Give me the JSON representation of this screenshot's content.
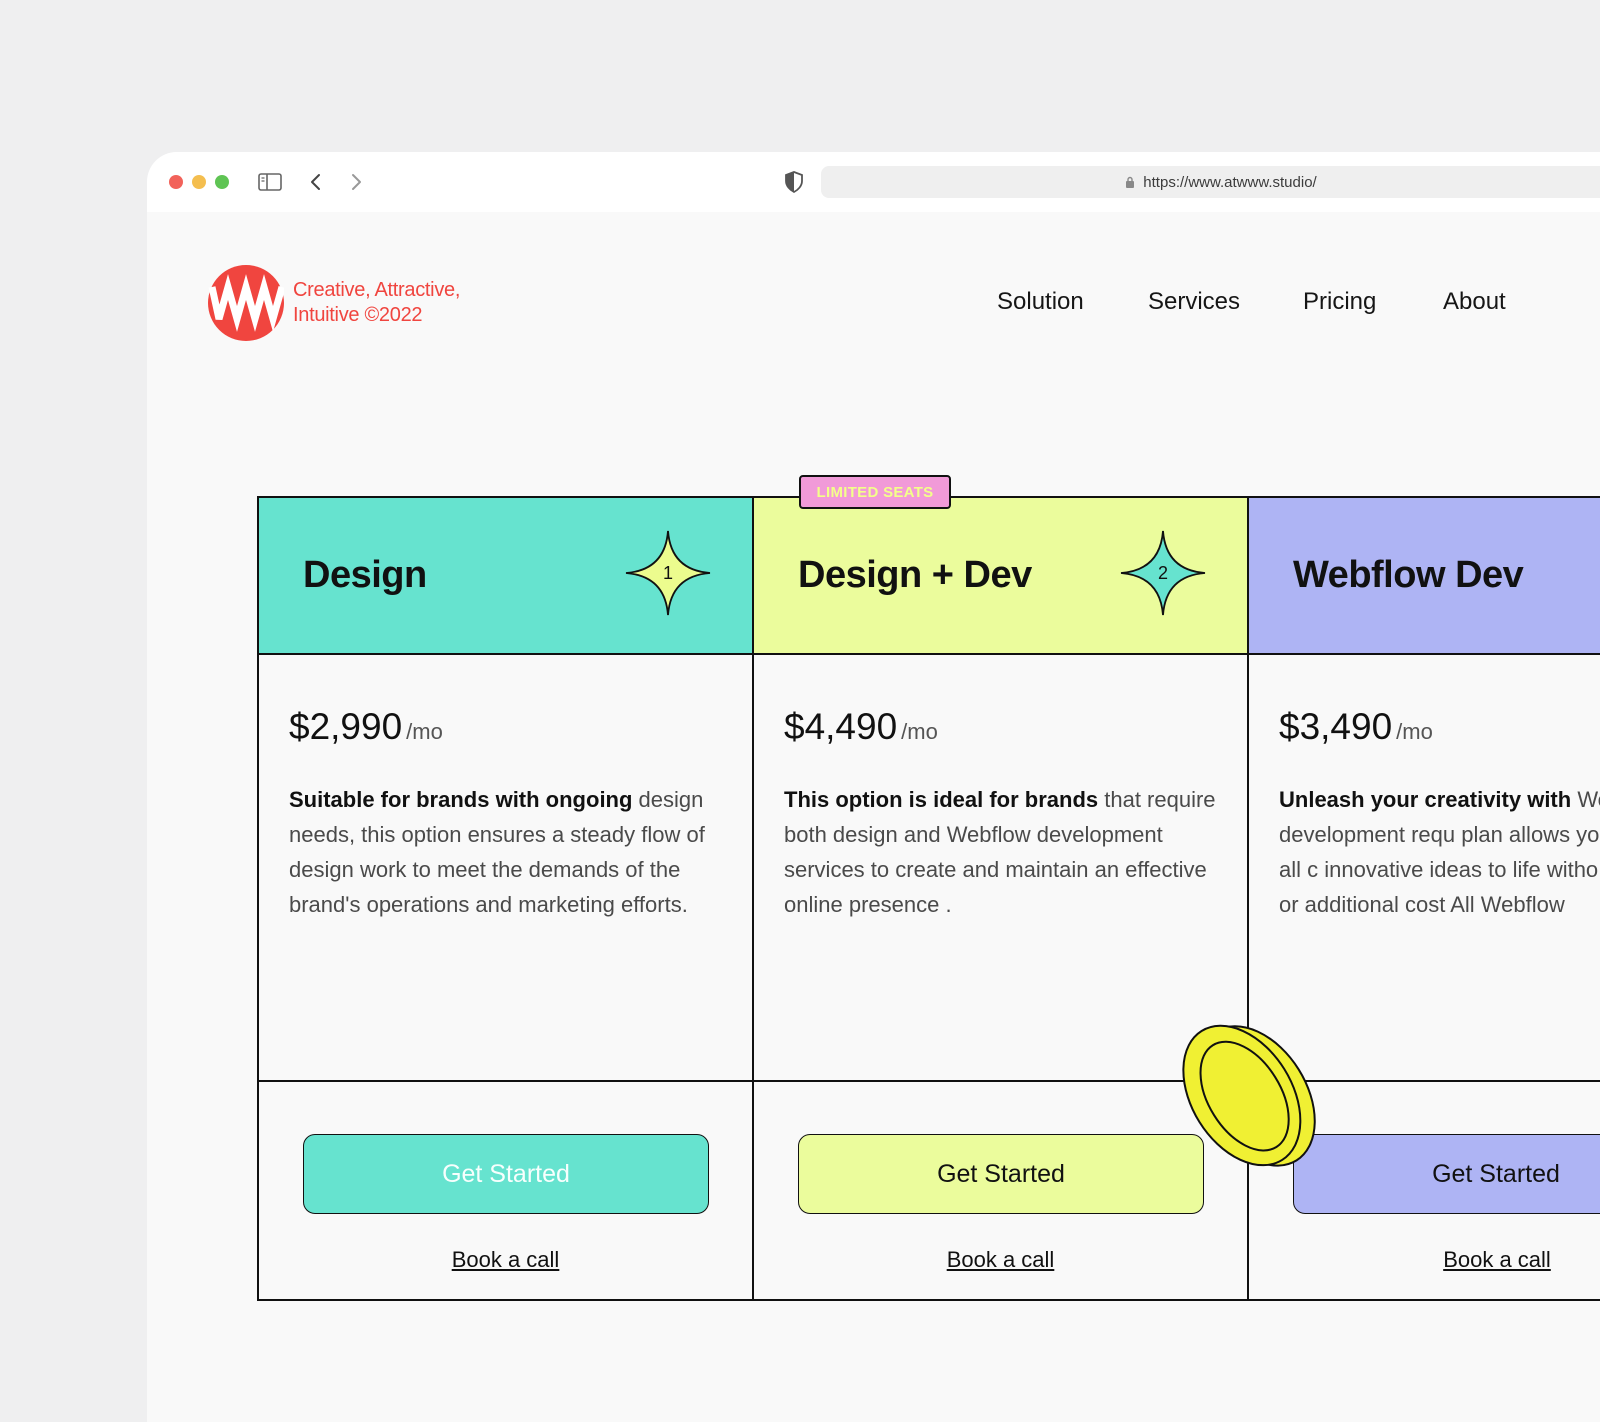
{
  "browser": {
    "url": "https://www.atwww.studio/"
  },
  "brand": {
    "tagline_line1": "Creative, Attractive,",
    "tagline_line2": "Intuitive ©2022",
    "logo_color": "#f0453f"
  },
  "nav": {
    "items": [
      {
        "label": "Solution"
      },
      {
        "label": "Services"
      },
      {
        "label": "Pricing"
      },
      {
        "label": "About"
      }
    ]
  },
  "badge": {
    "label": "LIMITED SEATS"
  },
  "plans": [
    {
      "title": "Design",
      "star_number": "1",
      "price": "$2,990",
      "period": "/mo",
      "desc_strong": "Suitable for brands with ongoing",
      "desc_rest": " design needs, this option ensures a steady flow of design work to meet the demands of the brand's operations and marketing efforts.",
      "cta": "Get Started",
      "link": "Book a call",
      "color": "#66e3cf",
      "star_color": "#ecfc8e"
    },
    {
      "title": "Design + Dev",
      "star_number": "2",
      "price": "$4,490",
      "period": "/mo",
      "desc_strong": "This option is ideal for brands",
      "desc_rest": " that require both design and Webflow development services to create and maintain an effective online presence .",
      "cta": "Get Started",
      "link": "Book a call",
      "color": "#ebfc9c",
      "star_color": "#66e3cf"
    },
    {
      "title": "Webflow Dev",
      "price": "$3,490",
      "period": "/mo",
      "desc_strong": "Unleash your creativity with",
      "desc_rest": " Webflow development requ plan allows you to bring all c innovative ideas to life witho limitations or additional cost All Webflow",
      "cta": "Get Started",
      "link": "Book a call",
      "color": "#aeb4f4"
    }
  ]
}
